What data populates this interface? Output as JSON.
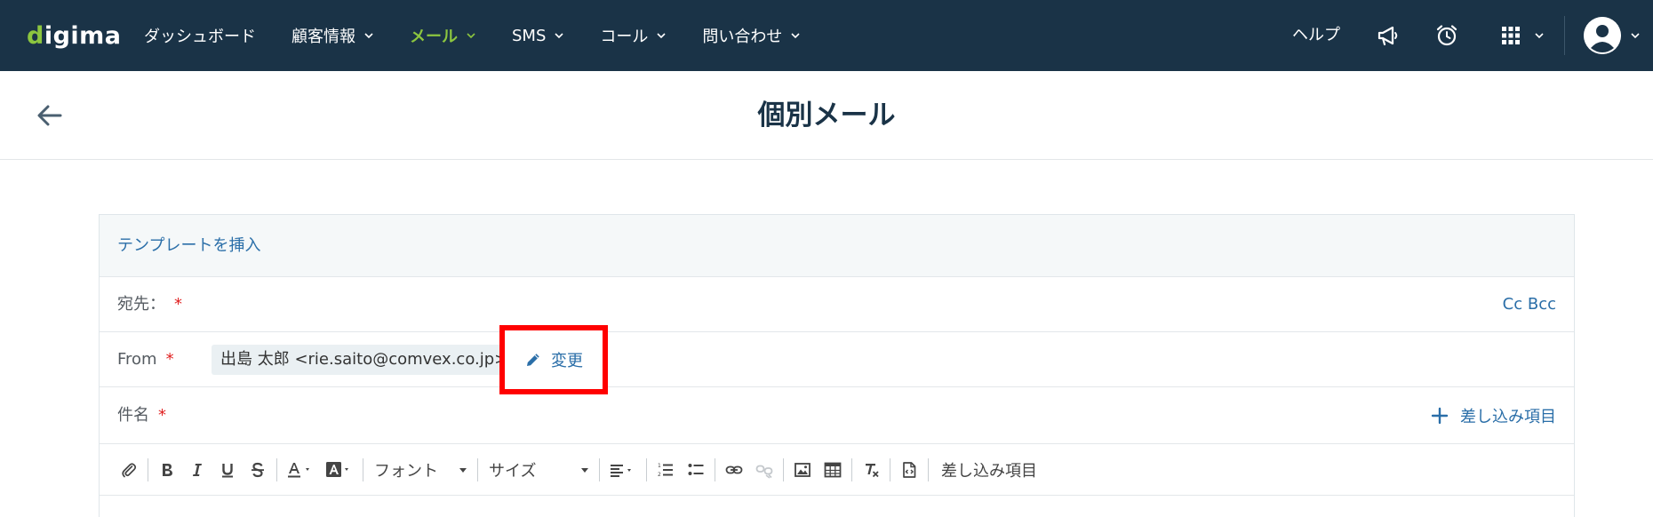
{
  "app": {
    "logo_text": "digima",
    "colors": {
      "nav_background": "#1a3347",
      "nav_active": "#8cc63f",
      "link": "#2a6ea8",
      "required_mark": "#e02020",
      "highlight_border": "#ff0000"
    }
  },
  "nav": {
    "items": [
      {
        "label": "ダッシュボード",
        "has_dropdown": false,
        "active": false
      },
      {
        "label": "顧客情報",
        "has_dropdown": true,
        "active": false
      },
      {
        "label": "メール",
        "has_dropdown": true,
        "active": true
      },
      {
        "label": "SMS",
        "has_dropdown": true,
        "active": false
      },
      {
        "label": "コール",
        "has_dropdown": true,
        "active": false
      },
      {
        "label": "問い合わせ",
        "has_dropdown": true,
        "active": false
      }
    ],
    "help_label": "ヘルプ",
    "icons": [
      "megaphone-icon",
      "alarm-clock-icon",
      "apps-grid-icon",
      "user-avatar-icon"
    ]
  },
  "page": {
    "title": "個別メール",
    "back_icon": "arrow-left-icon"
  },
  "form": {
    "template_link": "テンプレートを挿入",
    "to": {
      "label": "宛先：",
      "required_mark": "*",
      "cc_bcc": "Cc Bcc"
    },
    "from": {
      "label": "From",
      "required_mark": "*",
      "value": "出島 太郎 <rie.saito@comvex.co.jp>",
      "change_label": "変更"
    },
    "subject": {
      "label": "件名",
      "required_mark": "*",
      "merge_label": "差し込み項目"
    }
  },
  "toolbar": {
    "font_label": "フォント",
    "size_label": "サイズ",
    "merge_fields_label": "差し込み項目"
  }
}
